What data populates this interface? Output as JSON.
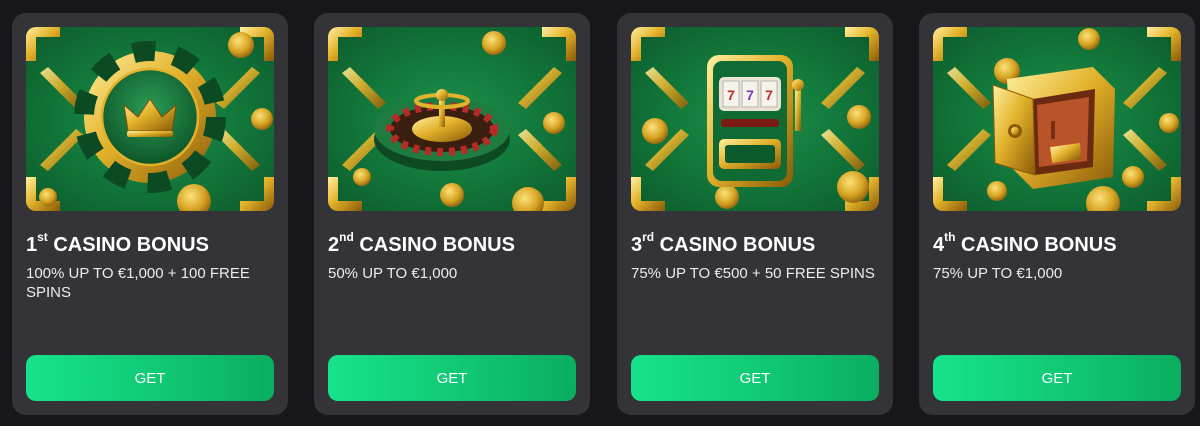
{
  "bonuses": [
    {
      "rank_num": "1",
      "rank_suffix": "st",
      "title_rest": " CASINO BONUS",
      "description": "100% UP TO €1,000 + 100 FREE SPINS",
      "button_label": "GET",
      "illustration": "poker-chip-crown"
    },
    {
      "rank_num": "2",
      "rank_suffix": "nd",
      "title_rest": " CASINO BONUS",
      "description": "50% UP TO €1,000",
      "button_label": "GET",
      "illustration": "roulette-wheel"
    },
    {
      "rank_num": "3",
      "rank_suffix": "rd",
      "title_rest": " CASINO BONUS",
      "description": "75% UP TO €500 + 50 FREE SPINS",
      "button_label": "GET",
      "illustration": "slot-machine"
    },
    {
      "rank_num": "4",
      "rank_suffix": "th",
      "title_rest": " CASINO BONUS",
      "description": "75% UP TO €1,000",
      "button_label": "GET",
      "illustration": "gold-safe"
    }
  ],
  "colors": {
    "card_bg": "#343438",
    "page_bg": "#16161b",
    "button": "#12d67e",
    "art_green": "#137a3c",
    "gold": "#d9a520"
  }
}
